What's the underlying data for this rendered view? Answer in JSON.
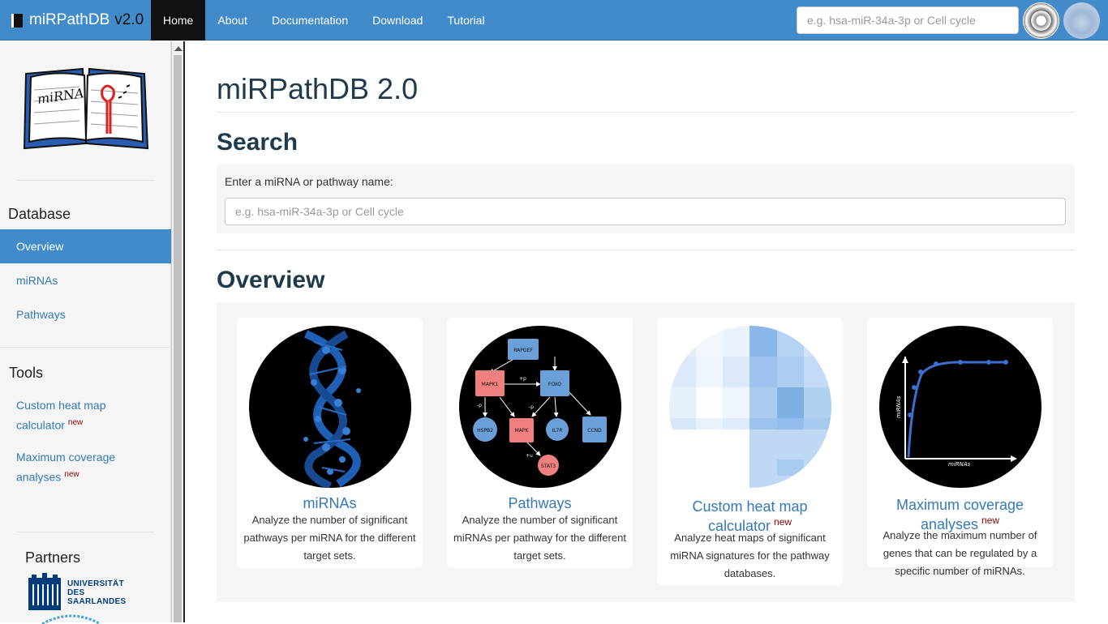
{
  "navbar": {
    "brand_name": "miRPathDB",
    "brand_version": "v2.0",
    "items": [
      "Home",
      "About",
      "Documentation",
      "Download",
      "Tutorial"
    ],
    "search_placeholder": "e.g. hsa-miR-34a-3p or Cell cycle"
  },
  "sidebar": {
    "database_heading": "Database",
    "database_items": [
      "Overview",
      "miRNAs",
      "Pathways"
    ],
    "tools_heading": "Tools",
    "tools": [
      {
        "label": "Custom heat map calculator",
        "badge": "new"
      },
      {
        "label": "Maximum coverage analyses",
        "badge": "new"
      }
    ],
    "partners_heading": "Partners",
    "partner_logo_text": [
      "UNIVERSITÄT",
      "DES",
      "SAARLANDES"
    ]
  },
  "main": {
    "title": "miRPathDB 2.0",
    "search_heading": "Search",
    "search_label": "Enter a miRNA or pathway name:",
    "search_placeholder": "e.g. hsa-miR-34a-3p or Cell cycle",
    "overview_heading": "Overview",
    "cards": [
      {
        "title": "miRNAs",
        "badge": "",
        "desc": "Analyze the number of significant pathways per miRNA for the different target sets."
      },
      {
        "title": "Pathways",
        "badge": "",
        "desc": "Analyze the number of significant miRNAs per pathway for the different target sets."
      },
      {
        "title": "Custom heat map calculator",
        "badge": "new",
        "desc": "Analyze heat maps of significant miRNA signatures for the pathway databases."
      },
      {
        "title": "Maximum coverage analyses",
        "badge": "new",
        "desc": "Analyze the maximum number of genes that can be regulated by a specific number of miRNAs."
      }
    ],
    "network_nodes": [
      "RAPGEF",
      "MAPK1",
      "FOXO",
      "HSPB2",
      "MAPK",
      "IL7R",
      "CCND",
      "STAT3"
    ],
    "network_edge_labels": [
      "+p",
      "-p",
      "-p",
      "+u"
    ],
    "coverage_axes": {
      "x": "miRNAs",
      "y": "miRNAs"
    }
  },
  "colors": {
    "navbar": "#428bca",
    "link": "#337ab7",
    "badge": "#8b0000",
    "node_red": "#f08080",
    "node_blue": "#6a9fd8"
  }
}
